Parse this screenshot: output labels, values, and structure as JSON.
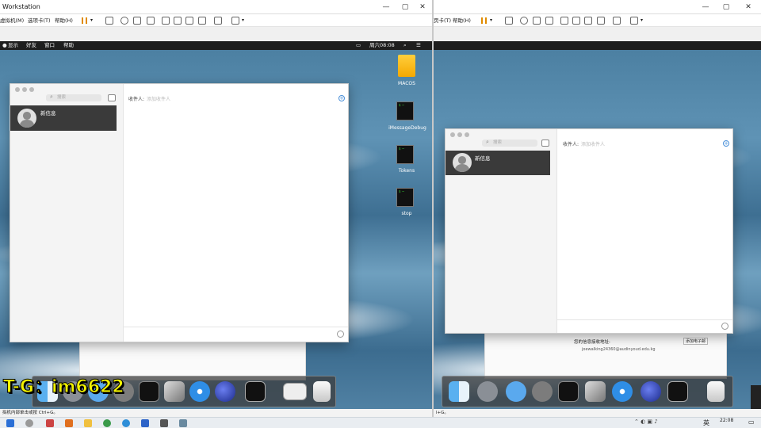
{
  "left_vm": {
    "title": "Workstation",
    "menu": [
      "虚拟机(M)",
      "选项卡(T)",
      "帮助(H)"
    ],
    "mac_menubar": [
      "显示",
      "好友",
      "窗口",
      "帮助"
    ],
    "clock": "周六08:08",
    "desktop_icons": [
      "MACOS",
      "iMessageDebug",
      "Tokens",
      "stop"
    ],
    "messages": {
      "search_placeholder": "搜索",
      "conversation_name": "新信息",
      "to_label": "收件人:",
      "to_placeholder": "添加收件人"
    },
    "status_text": "拟机内部单击或按 Ctrl+G。"
  },
  "right_vm": {
    "menu": [
      "页卡(T)",
      "帮助(H)"
    ],
    "messages": {
      "search_placeholder": "搜索",
      "conversation_name": "新信息",
      "to_label": "收件人:",
      "to_placeholder": "添加收件人"
    },
    "behind_window": {
      "label": "您的信息接收地址:",
      "email": "joewalking24360@audinyoud.edu.kg",
      "button": "添加电子邮"
    },
    "status_text": "l+G。"
  },
  "overlay_text": "T-G：im6622",
  "taskbar": {
    "ime": "英",
    "time": "22:08"
  },
  "colors": {
    "accent_yellow": "#f2f200",
    "dock_bg": "#3c3c3c",
    "selected_row": "#3a3a3a"
  }
}
